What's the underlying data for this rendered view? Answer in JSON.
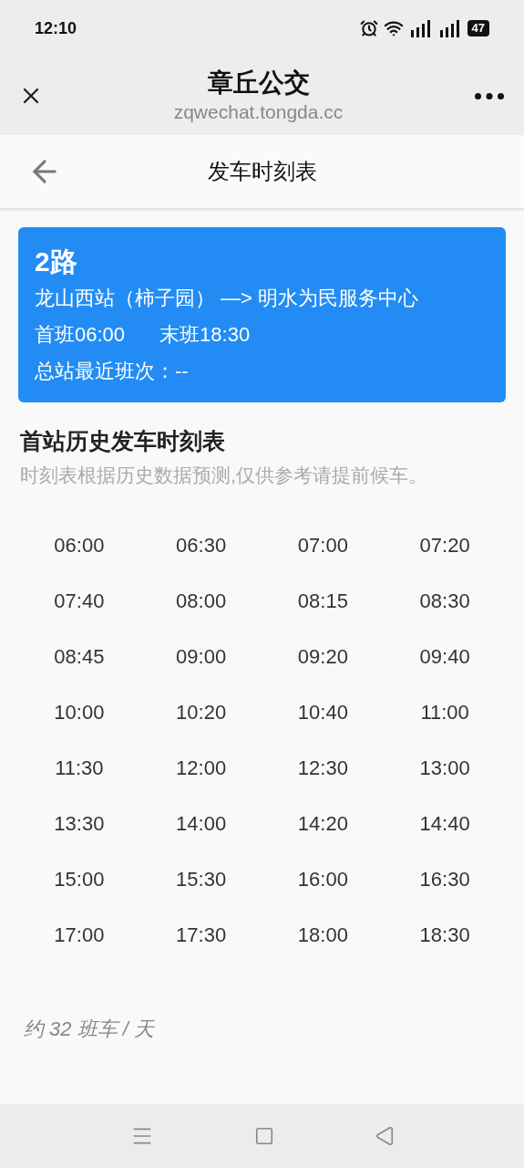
{
  "status_bar": {
    "time": "12:10",
    "battery": "47"
  },
  "browser": {
    "title": "章丘公交",
    "url": "zqwechat.tongda.cc"
  },
  "page": {
    "title": "发车时刻表"
  },
  "route_card": {
    "name": "2路",
    "direction": "龙山西站（柿子园） —> 明水为民服务中心",
    "first_bus": "首班06:00",
    "last_bus": "末班18:30",
    "latest": "总站最近班次：--"
  },
  "schedule": {
    "heading": "首站历史发车时刻表",
    "note": "时刻表根据历史数据预测,仅供参考请提前候车。",
    "times": [
      "06:00",
      "06:30",
      "07:00",
      "07:20",
      "07:40",
      "08:00",
      "08:15",
      "08:30",
      "08:45",
      "09:00",
      "09:20",
      "09:40",
      "10:00",
      "10:20",
      "10:40",
      "11:00",
      "11:30",
      "12:00",
      "12:30",
      "13:00",
      "13:30",
      "14:00",
      "14:20",
      "14:40",
      "15:00",
      "15:30",
      "16:00",
      "16:30",
      "17:00",
      "17:30",
      "18:00",
      "18:30"
    ],
    "summary": "约 32 班车 / 天"
  }
}
